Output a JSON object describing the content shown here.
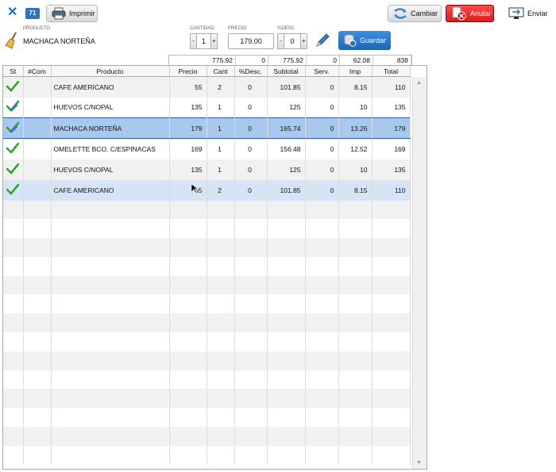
{
  "toolbar": {
    "badge": "71",
    "print_label": "Imprimir",
    "change_label": "Cambiar",
    "void_label": "Anular",
    "send_label": "Enviar"
  },
  "editor": {
    "product_label": "PRODUCTO",
    "product_value": "MACHACA NORTEÑA",
    "qty_label": "CANTIDAD",
    "qty_value": "1",
    "price_label": "PRECIO",
    "price_value": "179.00",
    "disc_label": "%DESC",
    "disc_value": "0",
    "minus": "-",
    "plus": "+",
    "save_label": "Guardar"
  },
  "totals": [
    "775.92",
    "0",
    "775.92",
    "0",
    "62.08",
    "838"
  ],
  "table": {
    "columns": [
      "St",
      "#Com",
      "Producto",
      "Precio",
      "Cant",
      "%Desc.",
      "Subtotal",
      "Serv.",
      "Imp",
      "Total"
    ],
    "rows": [
      {
        "status": "check",
        "com": "",
        "producto": "CAFE AMERICANO",
        "precio": "55",
        "cant": "2",
        "desc": "0",
        "subtotal": "101.85",
        "serv": "0",
        "imp": "8.15",
        "total": "110"
      },
      {
        "status": "check-edit",
        "com": "",
        "producto": "HUEVOS C/NOPAL",
        "precio": "135",
        "cant": "1",
        "desc": "0",
        "subtotal": "125",
        "serv": "0",
        "imp": "10",
        "total": "135"
      },
      {
        "status": "check-edit",
        "com": "",
        "producto": "MACHACA NORTEÑA",
        "precio": "179",
        "cant": "1",
        "desc": "0",
        "subtotal": "165.74",
        "serv": "0",
        "imp": "13.26",
        "total": "179"
      },
      {
        "status": "check",
        "com": "",
        "producto": "OMELETTE BCO. C/ESPINACAS",
        "precio": "169",
        "cant": "1",
        "desc": "0",
        "subtotal": "156.48",
        "serv": "0",
        "imp": "12.52",
        "total": "169"
      },
      {
        "status": "check",
        "com": "",
        "producto": "HUEVOS C/NOPAL",
        "precio": "135",
        "cant": "1",
        "desc": "0",
        "subtotal": "125",
        "serv": "0",
        "imp": "10",
        "total": "135"
      },
      {
        "status": "check",
        "com": "",
        "producto": "CAFE AMERICANO",
        "precio": "55",
        "cant": "2",
        "desc": "0",
        "subtotal": "101.85",
        "serv": "0",
        "imp": "8.15",
        "total": "110"
      }
    ],
    "selected_row": 2,
    "highlighted_row": 5
  },
  "colors": {
    "accent": "#1e63b8",
    "danger": "#d81d1d",
    "selected": "#a9c8ee"
  }
}
